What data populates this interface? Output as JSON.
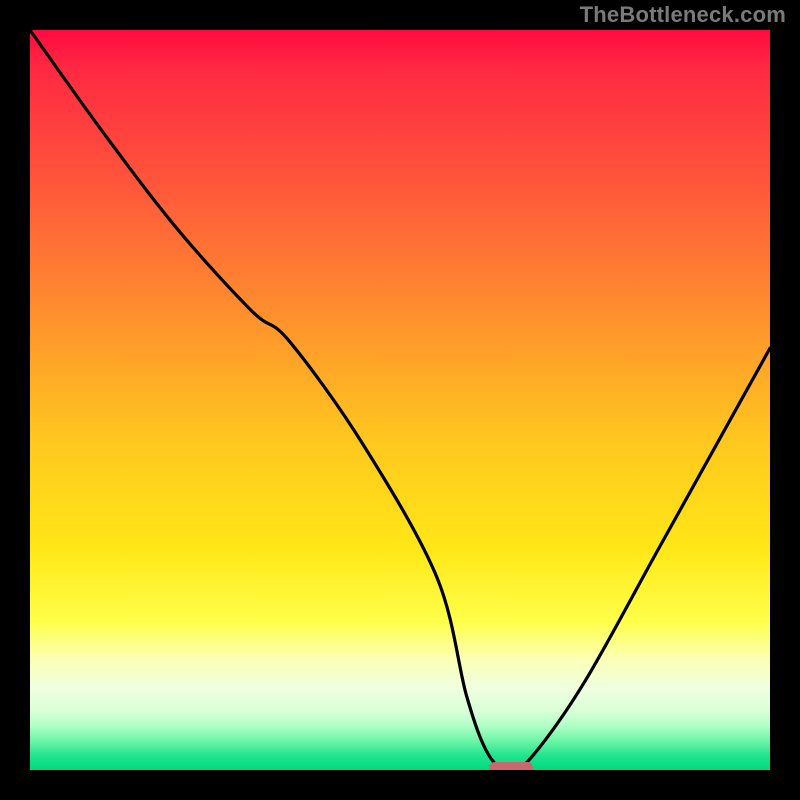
{
  "watermark": "TheBottleneck.com",
  "colors": {
    "page_bg": "#000000",
    "watermark": "#7a7a7a",
    "curve": "#000000",
    "marker": "#c86a6b"
  },
  "chart_data": {
    "type": "line",
    "title": "",
    "xlabel": "",
    "ylabel": "",
    "xlim": [
      0,
      100
    ],
    "ylim": [
      0,
      100
    ],
    "grid": false,
    "legend": false,
    "series": [
      {
        "name": "bottleneck-curve",
        "x": [
          0,
          10,
          20,
          30,
          35,
          45,
          55,
          59,
          62,
          65,
          68,
          75,
          85,
          95,
          100
        ],
        "values": [
          100,
          86,
          73,
          62,
          58,
          44,
          26,
          10,
          2,
          0,
          2,
          12,
          30,
          48,
          57
        ]
      }
    ],
    "optimal_marker": {
      "x_start": 62,
      "x_end": 68,
      "y": 0
    },
    "background_gradient": {
      "from": "red",
      "to": "green",
      "meaning": "high-bottleneck (top/red) to optimal (bottom/green)"
    }
  }
}
